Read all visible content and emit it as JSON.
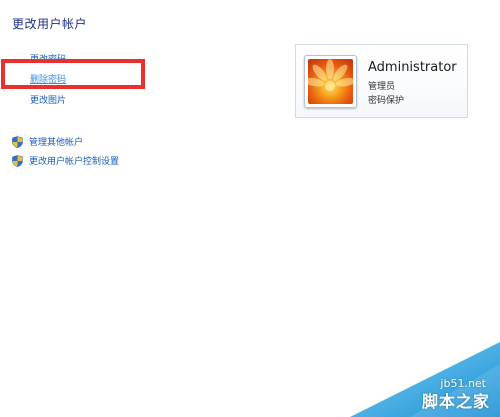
{
  "page": {
    "title": "更改用户帐户"
  },
  "tasks": [
    {
      "label": "更改密码"
    },
    {
      "label": "删除密码"
    },
    {
      "label": "更改图片"
    }
  ],
  "related_links": [
    {
      "label": "管理其他帐户",
      "icon": "uac-shield-icon"
    },
    {
      "label": "更改用户帐户控制设置",
      "icon": "uac-shield-icon"
    }
  ],
  "account": {
    "name": "Administrator",
    "role": "管理员",
    "password_status": "密码保护",
    "avatar_icon": "flower-avatar"
  },
  "watermark": {
    "domain": "jb51.net",
    "brand": "脚本之家"
  },
  "colors": {
    "link": "#1a5bb8",
    "title": "#1e3287",
    "highlight": "#e8302f"
  }
}
